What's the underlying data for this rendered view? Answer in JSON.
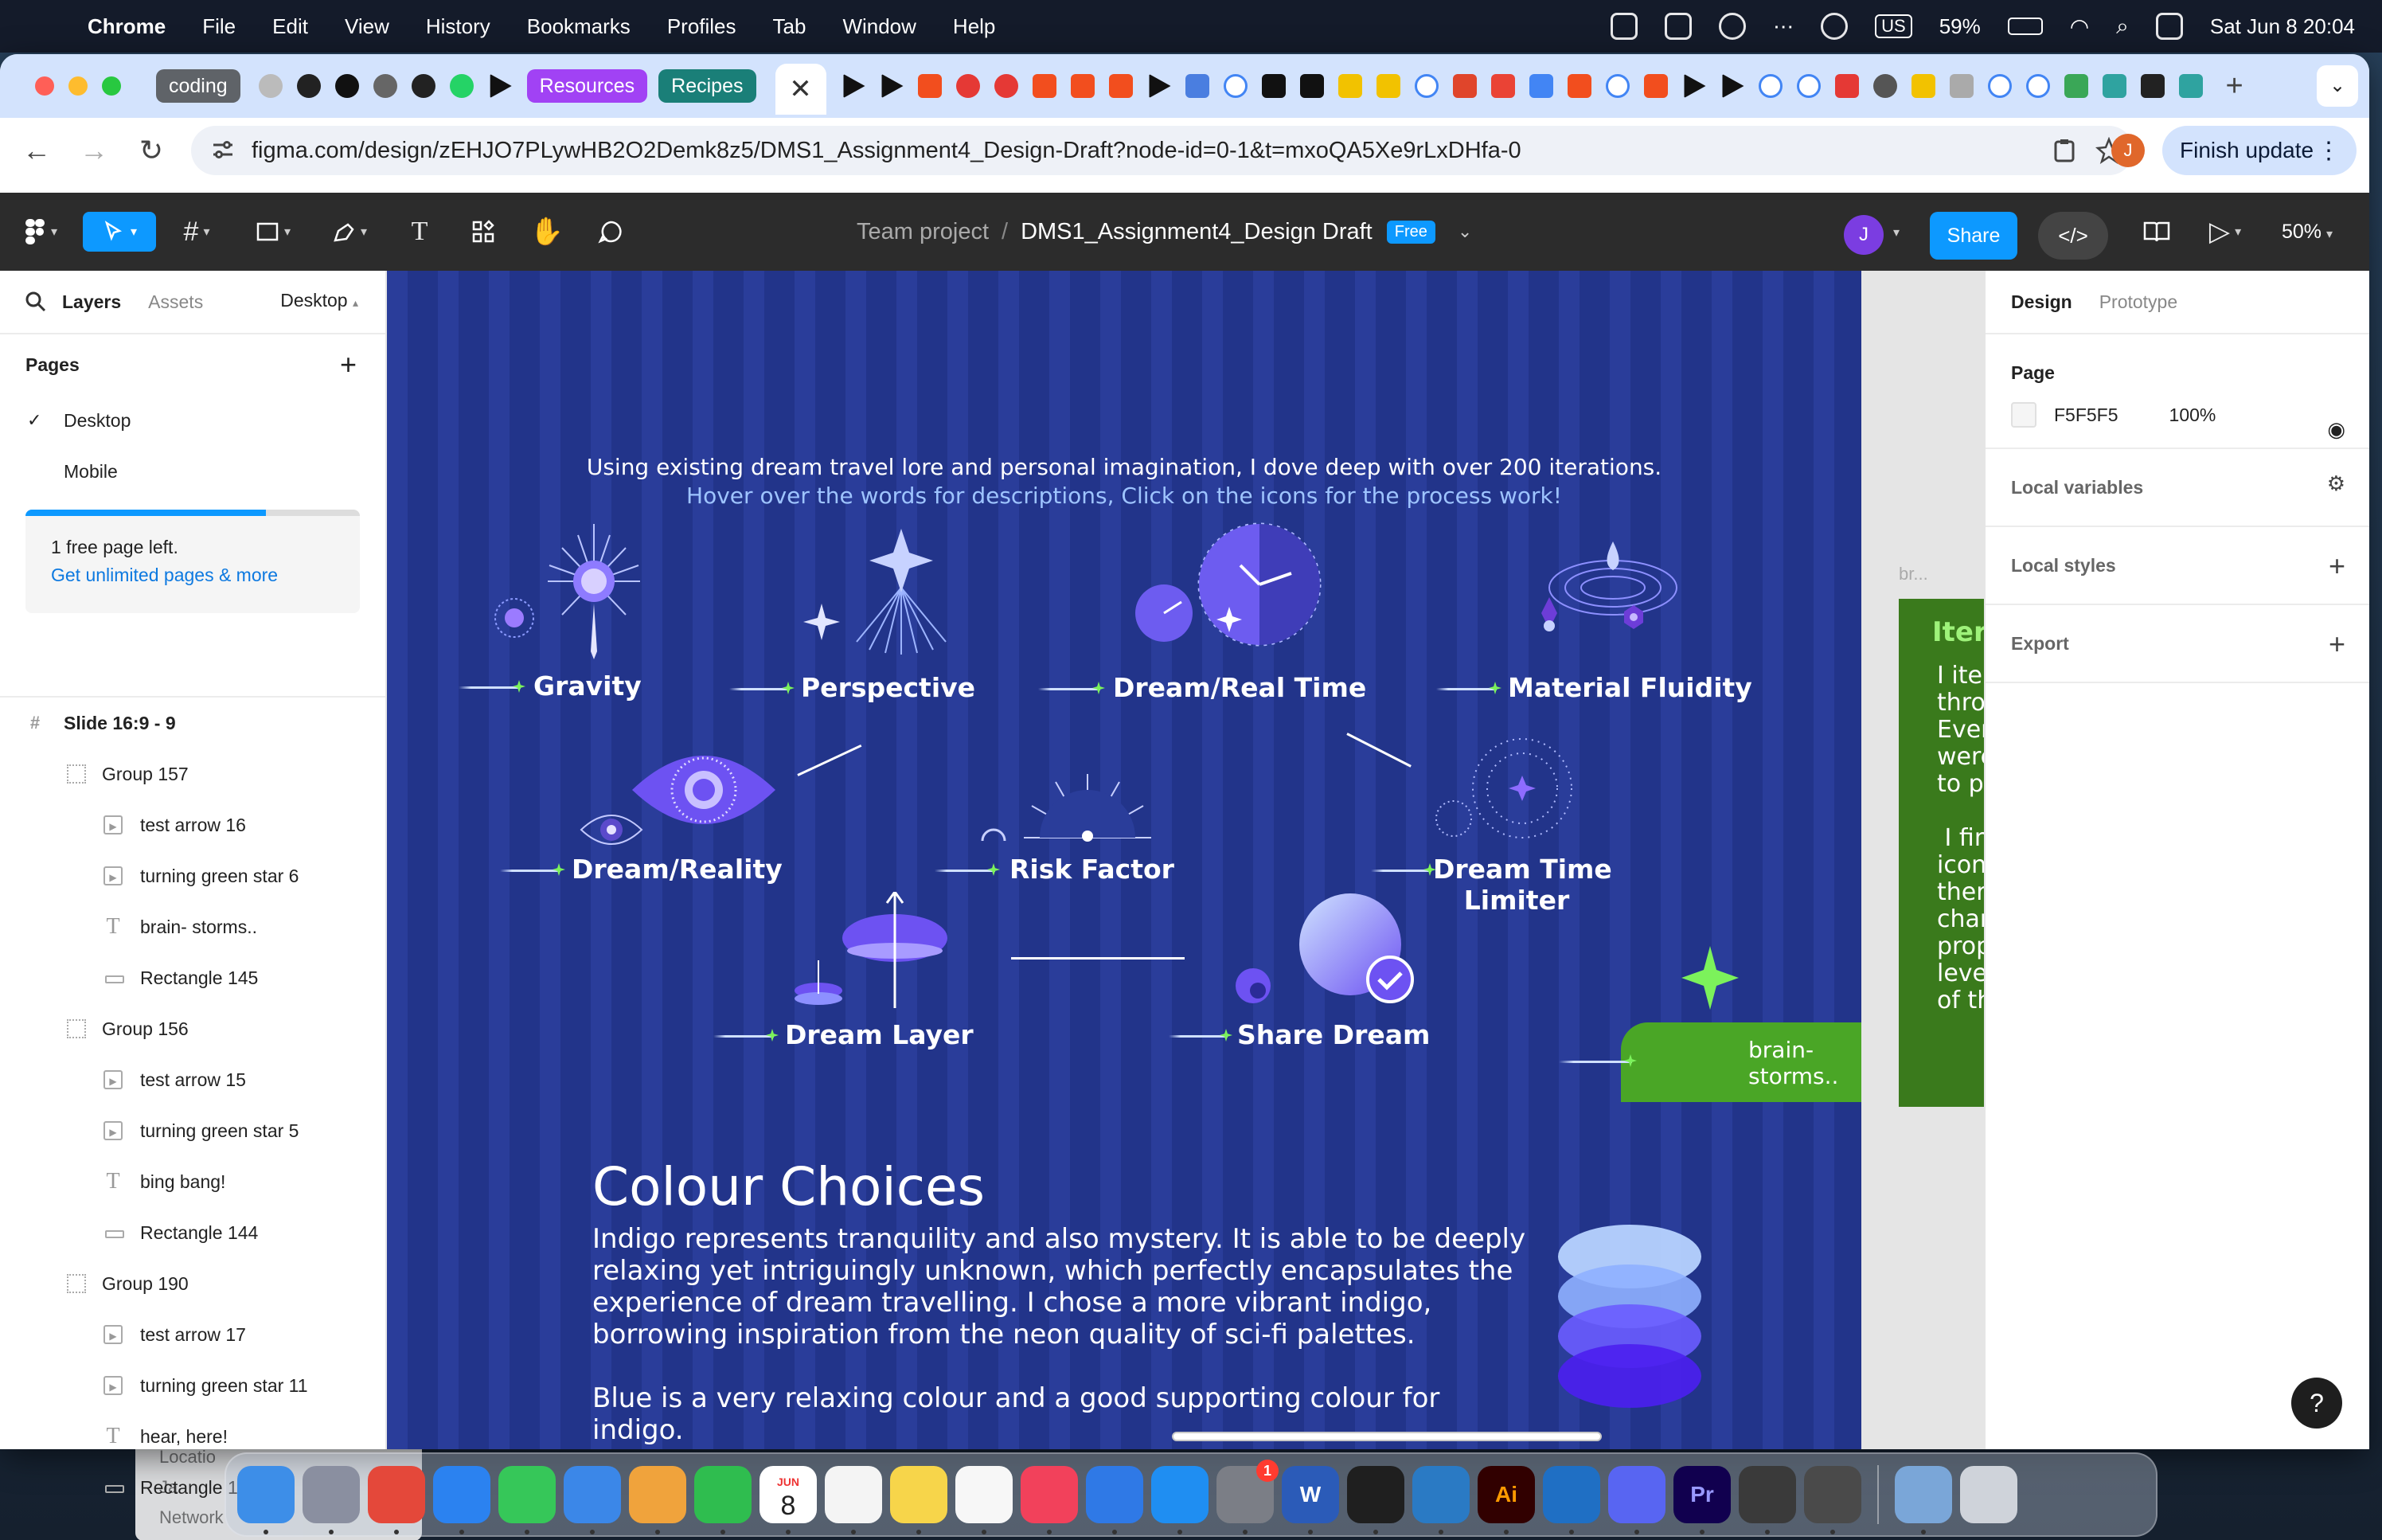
{
  "menubar": {
    "app": "Chrome",
    "items": [
      "File",
      "Edit",
      "View",
      "History",
      "Bookmarks",
      "Profiles",
      "Tab",
      "Window",
      "Help"
    ],
    "input_source": "US",
    "battery": "59%",
    "datetime": "Sat Jun 8  20:04"
  },
  "tabs": {
    "groups": [
      {
        "label": "coding",
        "color": "#5f6368"
      },
      {
        "label": "Resources",
        "color": "#a142f4"
      },
      {
        "label": "Recipes",
        "color": "#1a7f78"
      }
    ],
    "active_close": "✕",
    "new_tab": "+",
    "menu": "⌄"
  },
  "toolbar": {
    "url": "figma.com/design/zEHJO7PLywHB2O2Demk8z5/DMS1_Assignment4_Design-Draft?node-id=0-1&t=mxoQA5Xe9rLxDHfa-0",
    "profile_initial": "J",
    "finish_update": "Finish update"
  },
  "figma": {
    "breadcrumb_team": "Team project",
    "file_name": "DMS1_Assignment4_Design Draft",
    "plan_badge": "Free",
    "avatar": "J",
    "share": "Share",
    "zoom": "50%",
    "left": {
      "tab_layers": "Layers",
      "tab_assets": "Assets",
      "page_selector": "Desktop",
      "pages_heading": "Pages",
      "pages": [
        "Desktop",
        "Mobile"
      ],
      "upsell_text": "1 free page left.",
      "upsell_link": "Get unlimited pages & more",
      "upsell_progress": 0.72,
      "layers": [
        {
          "level": 0,
          "type": "frame",
          "name": "Slide 16:9 - 9"
        },
        {
          "level": 1,
          "type": "group",
          "name": "Group 157"
        },
        {
          "level": 2,
          "type": "gif",
          "name": "test arrow 16"
        },
        {
          "level": 2,
          "type": "gif",
          "name": "turning green star 6"
        },
        {
          "level": 2,
          "type": "text",
          "name": "brain- storms.."
        },
        {
          "level": 2,
          "type": "rect",
          "name": "Rectangle 145"
        },
        {
          "level": 1,
          "type": "group",
          "name": "Group 156"
        },
        {
          "level": 2,
          "type": "gif",
          "name": "test arrow 15"
        },
        {
          "level": 2,
          "type": "gif",
          "name": "turning green star 5"
        },
        {
          "level": 2,
          "type": "text",
          "name": "bing bang!"
        },
        {
          "level": 2,
          "type": "rect",
          "name": "Rectangle 144"
        },
        {
          "level": 1,
          "type": "group",
          "name": "Group 190"
        },
        {
          "level": 2,
          "type": "gif",
          "name": "test arrow 17"
        },
        {
          "level": 2,
          "type": "gif",
          "name": "turning green star 11"
        },
        {
          "level": 2,
          "type": "text",
          "name": "hear, here!"
        },
        {
          "level": 2,
          "type": "rect",
          "name": "Rectangle 146"
        }
      ]
    },
    "right": {
      "tab_design": "Design",
      "tab_prototype": "Prototype",
      "page_heading": "Page",
      "page_color": "F5F5F5",
      "page_opacity": "100%",
      "local_variables": "Local variables",
      "local_styles": "Local styles",
      "export": "Export"
    },
    "canvas": {
      "intro_line1": "Using existing dream travel lore and personal imagination, I dove deep with over 200 iterations.",
      "intro_line2": "Hover over the words for descriptions, Click on the icons for the process work!",
      "labels": {
        "gravity": "Gravity",
        "perspective": "Perspective",
        "dream_real_time": "Dream/Real Time",
        "material_fluidity": "Material Fluidity",
        "dream_reality": "Dream/Reality",
        "risk_factor": "Risk Factor",
        "dream_time_limiter_1": "Dream Time",
        "dream_time_limiter_2": "Limiter",
        "dream_layer": "Dream Layer",
        "share_dream": "Share Dream"
      },
      "brainstorm_tag": "brain-\nstorms..",
      "colour_title": "Colour Choices",
      "colour_p1": "Indigo represents tranquility and also mystery. It is able to be deeply relaxing yet intriguingly unknown, which perfectly encapsulates the experience of dream travelling. I chose a more vibrant indigo, borrowing inspiration from the neon quality of sci-fi palettes.",
      "colour_p2": "Blue is a very relaxing colour and a good supporting colour for indigo.",
      "side_frame_label": "br...",
      "side_frame_heading": "Itera",
      "side_frame_body": "I iter\nthro\nEver\nwere\nto p\n\n I fin\nicon\nther\nchar\nprop\nleve\nof th"
    }
  },
  "finder_peek": [
    "Locatio",
    "Ja",
    "Network"
  ],
  "dock": [
    {
      "name": "Finder",
      "color": "#3d8ee8"
    },
    {
      "name": "Launchpad",
      "color": "#8a8fa0"
    },
    {
      "name": "Chrome",
      "color": "#e4483a"
    },
    {
      "name": "Safari",
      "color": "#2b82f0"
    },
    {
      "name": "Messages",
      "color": "#36c759"
    },
    {
      "name": "Mail",
      "color": "#3b87e8"
    },
    {
      "name": "Photos",
      "color": "#f0a33c"
    },
    {
      "name": "FaceTime",
      "color": "#2fbd4f"
    },
    {
      "name": "Calendar",
      "color": "#ffffff"
    },
    {
      "name": "Reminders",
      "color": "#f4f4f4"
    },
    {
      "name": "Notes",
      "color": "#f7d54a"
    },
    {
      "name": "Freeform",
      "color": "#f7f7f7"
    },
    {
      "name": "Music",
      "color": "#f2415b"
    },
    {
      "name": "Keynote",
      "color": "#2f79e6"
    },
    {
      "name": "App Store",
      "color": "#1f8ef2"
    },
    {
      "name": "System Settings",
      "color": "#7b7e86"
    },
    {
      "name": "Word",
      "color": "#2b5bb8"
    },
    {
      "name": "Spotify",
      "color": "#1f1f1f"
    },
    {
      "name": "VS Code",
      "color": "#2a7ac4"
    },
    {
      "name": "Illustrator",
      "color": "#310000"
    },
    {
      "name": "Outlook",
      "color": "#1f6fc4"
    },
    {
      "name": "Discord",
      "color": "#5865f2"
    },
    {
      "name": "Premiere Pro",
      "color": "#11004f"
    },
    {
      "name": "Unity",
      "color": "#3a3a3a"
    },
    {
      "name": "Unity Hub",
      "color": "#4a4a4a"
    },
    {
      "name": "Preview",
      "color": "#7aa6d8"
    }
  ],
  "dock_texts": {
    "calendar_month": "JUN",
    "calendar_day": "8",
    "settings_badge": "1",
    "illustrator": "Ai",
    "premiere": "Pr",
    "word": "W"
  },
  "colors": {
    "figma_blue": "#0d99ff",
    "slide_indigo": "#2a3d9a",
    "brainstorm_green": "#4aa626"
  }
}
